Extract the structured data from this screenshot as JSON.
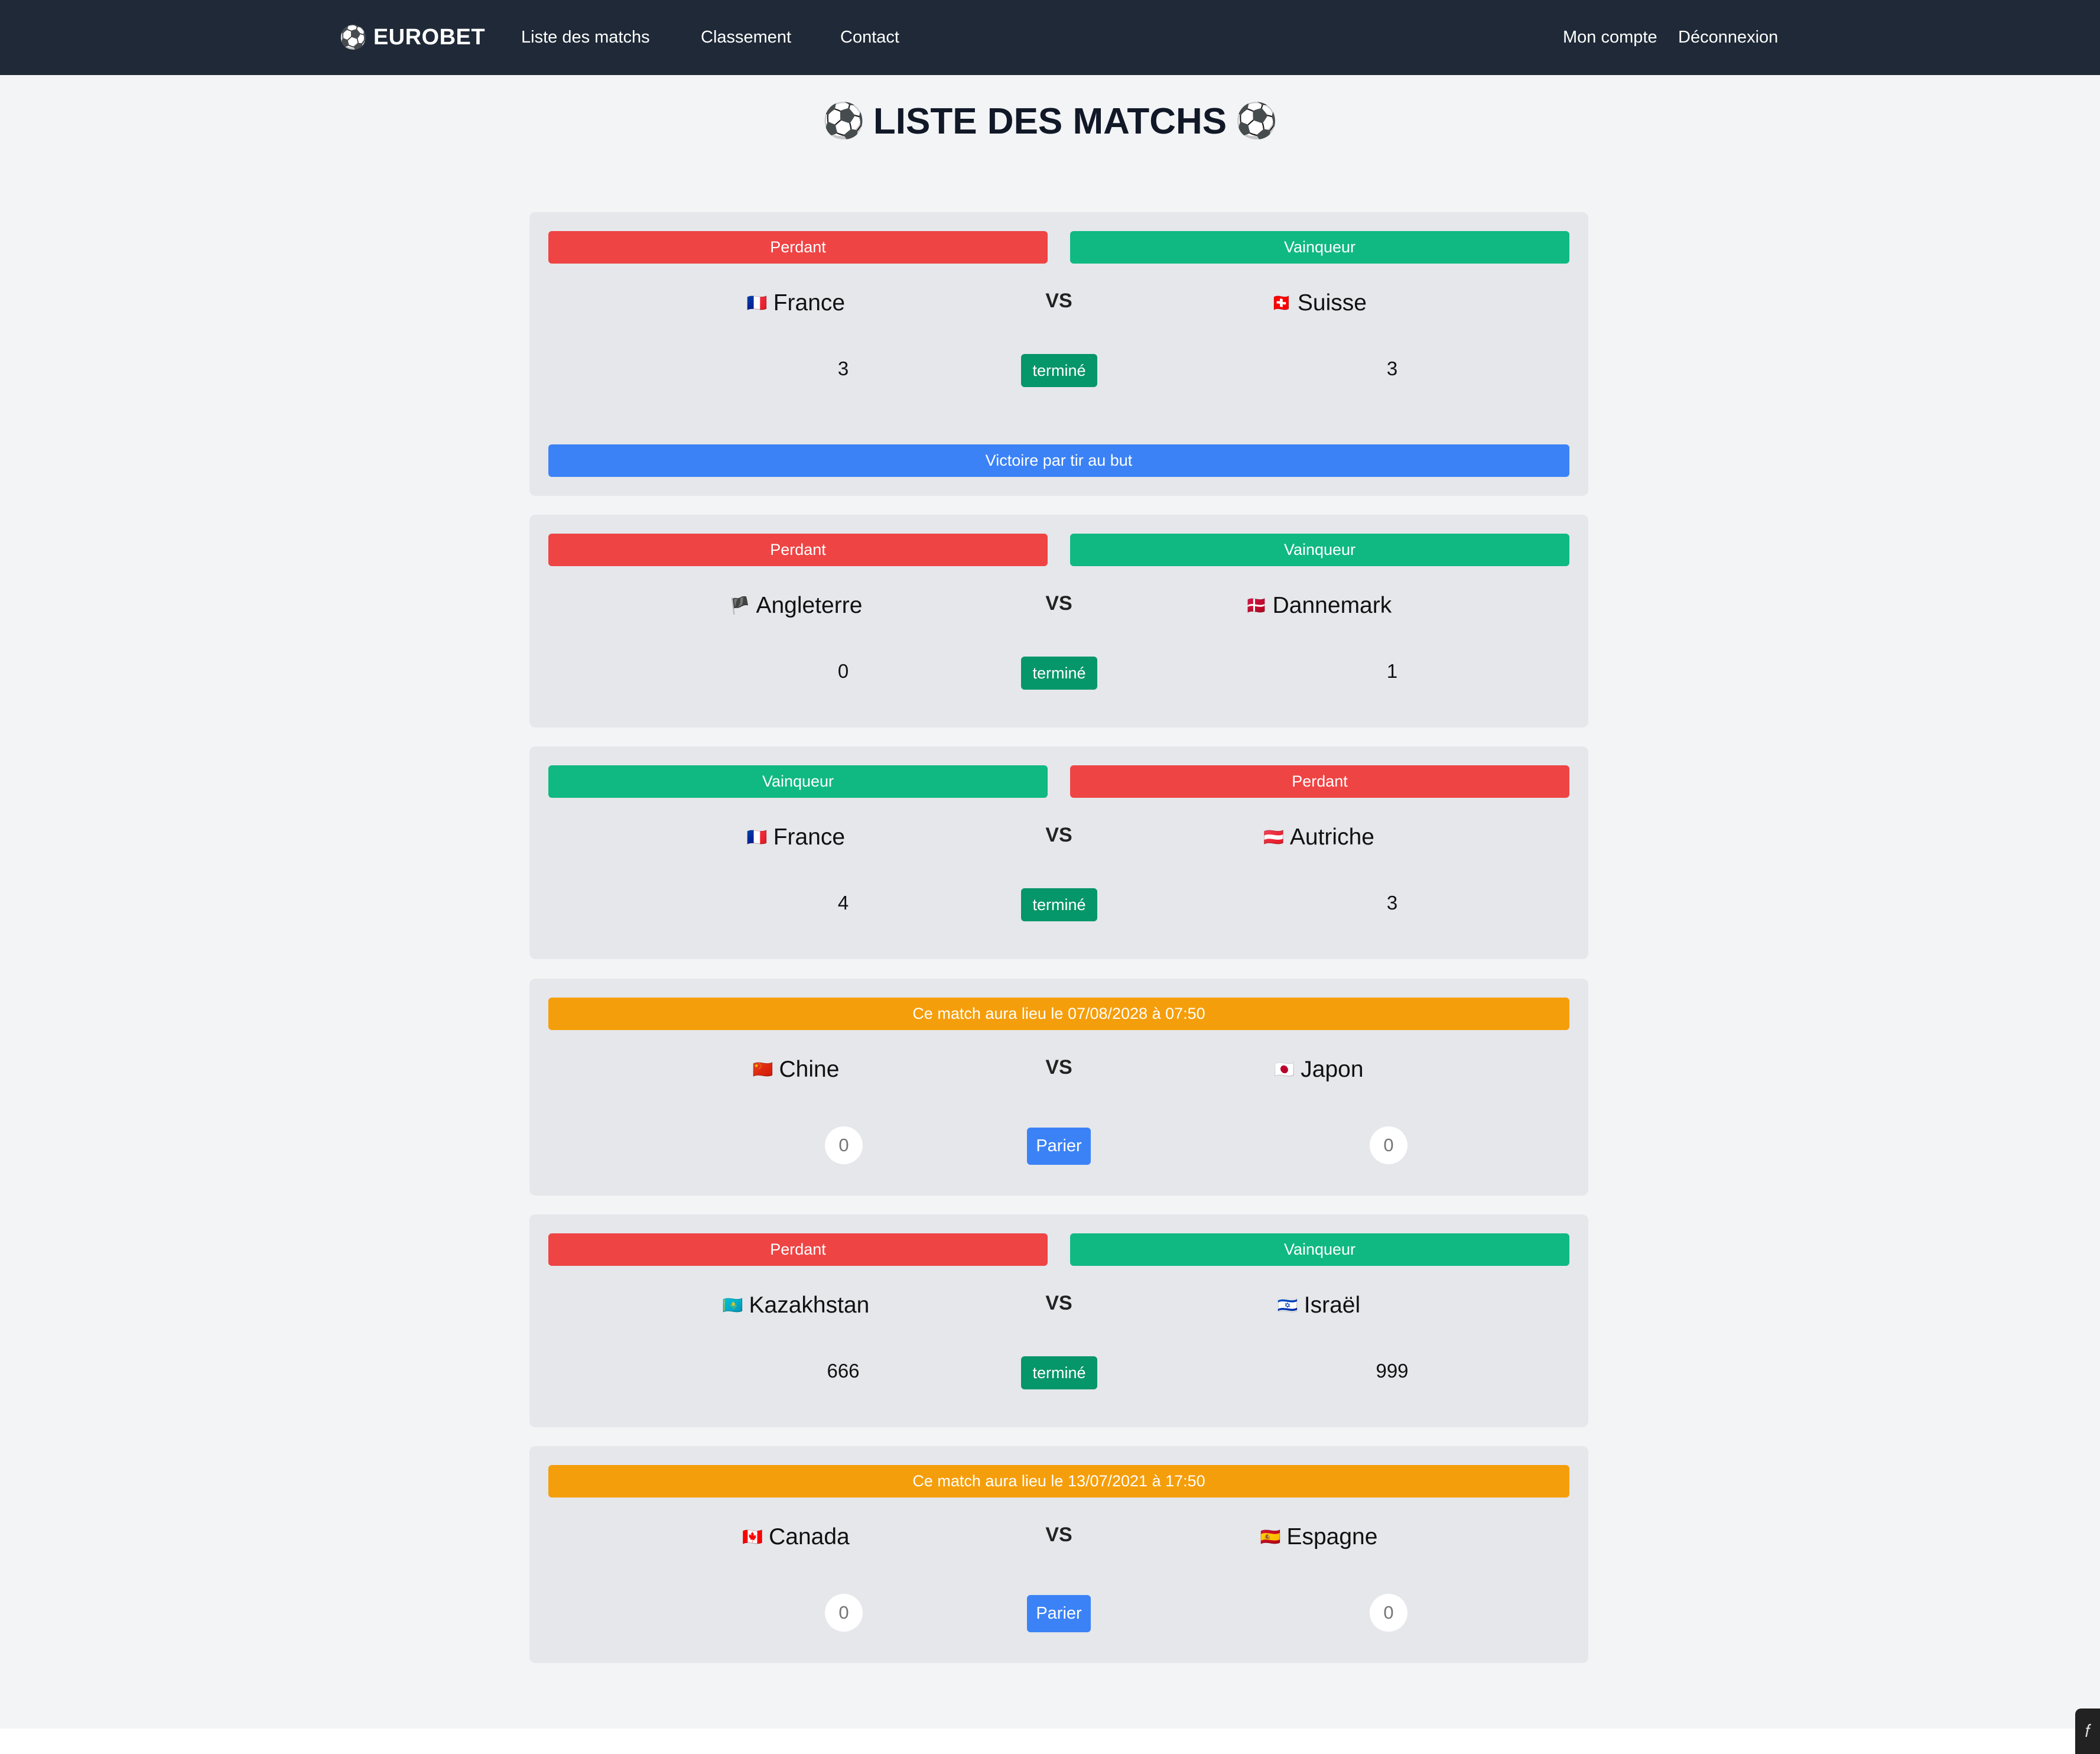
{
  "navbar": {
    "brand": "EUROBET",
    "brand_icon": "soccer-ball-icon",
    "links": [
      "Liste des matchs",
      "Classement",
      "Contact"
    ],
    "account": "Mon compte",
    "logout": "Déconnexion"
  },
  "page": {
    "title": "LISTE DES MATCHS",
    "title_icon": "⚽"
  },
  "matches": [
    {
      "left_result": "Perdant",
      "right_result": "Vainqueur",
      "left_team": "France",
      "left_flag": "🇫🇷",
      "right_team": "Suisse",
      "right_flag": "🇨🇭",
      "vs": "VS",
      "left_score": "3",
      "right_score": "3",
      "status": "terminé",
      "note": "Victoire par tir au but"
    },
    {
      "left_result": "Perdant",
      "right_result": "Vainqueur",
      "left_team": "Angleterre",
      "left_flag": "🏴",
      "right_team": "Dannemark",
      "right_flag": "🇩🇰",
      "vs": "VS",
      "left_score": "0",
      "right_score": "1",
      "status": "terminé"
    },
    {
      "left_result": "Vainqueur",
      "right_result": "Perdant",
      "left_team": "France",
      "left_flag": "🇫🇷",
      "right_team": "Autriche",
      "right_flag": "🇦🇹",
      "vs": "VS",
      "left_score": "4",
      "right_score": "3",
      "status": "terminé"
    },
    {
      "schedule": "Ce match aura lieu le 07/08/2028 à 07:50",
      "left_team": "Chine",
      "left_flag": "🇨🇳",
      "right_team": "Japon",
      "right_flag": "🇯🇵",
      "vs": "VS",
      "left_bet": "0",
      "right_bet": "0",
      "bet_label": "Parier"
    },
    {
      "left_result": "Perdant",
      "right_result": "Vainqueur",
      "left_team": "Kazakhstan",
      "left_flag": "🇰🇿",
      "right_team": "Israël",
      "right_flag": "🇮🇱",
      "vs": "VS",
      "left_score": "666",
      "right_score": "999",
      "status": "terminé"
    },
    {
      "schedule": "Ce match aura lieu le 13/07/2021 à 17:50",
      "left_team": "Canada",
      "left_flag": "🇨🇦",
      "right_team": "Espagne",
      "right_flag": "🇪🇸",
      "vs": "VS",
      "left_bet": "0",
      "right_bet": "0",
      "bet_label": "Parier"
    }
  ],
  "colors": {
    "navbar": "#1f2937",
    "loser": "#ef4444",
    "winner": "#10b981",
    "scheduled": "#f59e0b",
    "info": "#3b82f6",
    "status": "#059669"
  }
}
